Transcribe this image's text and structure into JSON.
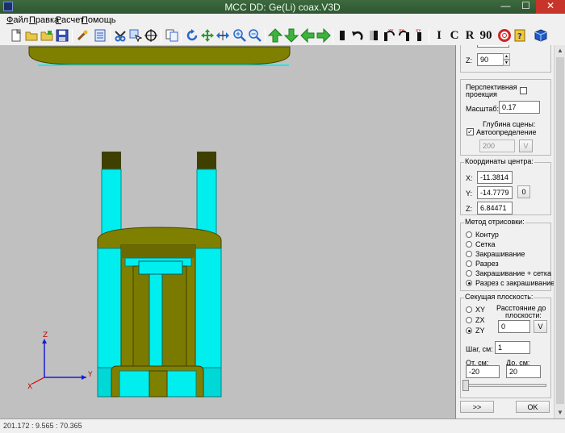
{
  "window": {
    "title": "MCC DD: Ge(Li) coax.V3D"
  },
  "menu": [
    {
      "label": "Файл",
      "key": "Ф",
      "rest": "айл"
    },
    {
      "label": "Правка",
      "key": "П",
      "rest": "равка"
    },
    {
      "label": "Расчет",
      "key": "Р",
      "rest": "асчет"
    },
    {
      "label": "Помощь",
      "key": "П",
      "rest": "омощь"
    }
  ],
  "toolbar": {
    "icons": [
      "new-file-icon",
      "open-folder-icon",
      "open-recent-icon",
      "save-icon",
      "tool-wand-icon",
      "properties-icon",
      "cut-tool-icon",
      "select-tool-icon",
      "crosshair-icon",
      "copy-icon",
      "rotate-icon",
      "move-all-icon",
      "fit-width-icon",
      "zoom-in-icon",
      "zoom-out-icon",
      "arrow-up-icon",
      "arrow-down-icon",
      "arrow-left-icon",
      "arrow-right-icon",
      "bar-icon",
      "undo-arc-icon",
      "half-bar-icon",
      "rotate-xy-left-icon",
      "rotate-xy-right-icon",
      "rotate-x-icon"
    ],
    "letters": [
      "I",
      "C",
      "R",
      "90"
    ],
    "end_icons": [
      "lifebuoy-icon",
      "help-book-icon",
      "cube-icon"
    ]
  },
  "panel": {
    "z_rotation": {
      "label": "Z:",
      "value": "90"
    },
    "projection": {
      "label_line1": "Перспективная",
      "label_line2": "проекция",
      "checked": false
    },
    "scale": {
      "label": "Масштаб:",
      "value": "0.17"
    },
    "depth": {
      "title": "Глубина сцены:",
      "auto_label": "Автоопределение",
      "auto_checked": true,
      "value": "200",
      "button": "V"
    },
    "center": {
      "title": "Координаты центра:",
      "x_label": "X:",
      "x_value": "-11.3814",
      "y_label": "Y:",
      "y_value": "-14.7779",
      "z_label": "Z:",
      "z_value": "6.84471",
      "zero_button": "0"
    },
    "render": {
      "title": "Метод отрисовки:",
      "options": [
        "Контур",
        "Сетка",
        "Закрашивание",
        "Разрез",
        "Закрашивание + сетка",
        "Разрез с закрашиванием"
      ],
      "selected": 5
    },
    "section": {
      "title": "Секущая плоскость:",
      "planes": [
        "XY",
        "ZX",
        "ZY"
      ],
      "selected": 2,
      "distance_label_1": "Расстояние до",
      "distance_label_2": "плоскости:",
      "distance_value": "0",
      "distance_button": "V",
      "step_label": "Шаг, см:",
      "step_value": "1",
      "from_label": "От, см:",
      "from_value": "-20",
      "to_label": "До, см:",
      "to_value": "20"
    },
    "buttons": {
      "next": ">>",
      "ok": "OK"
    }
  },
  "axes": {
    "z_label": "Z",
    "y_label": "Y",
    "x_label": "X"
  },
  "colors": {
    "cyan": "#00eeee",
    "olive": "#808000",
    "olive_dark": "#3f3f00",
    "background": "#c0c0c0"
  },
  "status": {
    "text": "201.172 : 9.565 : 70.365"
  }
}
